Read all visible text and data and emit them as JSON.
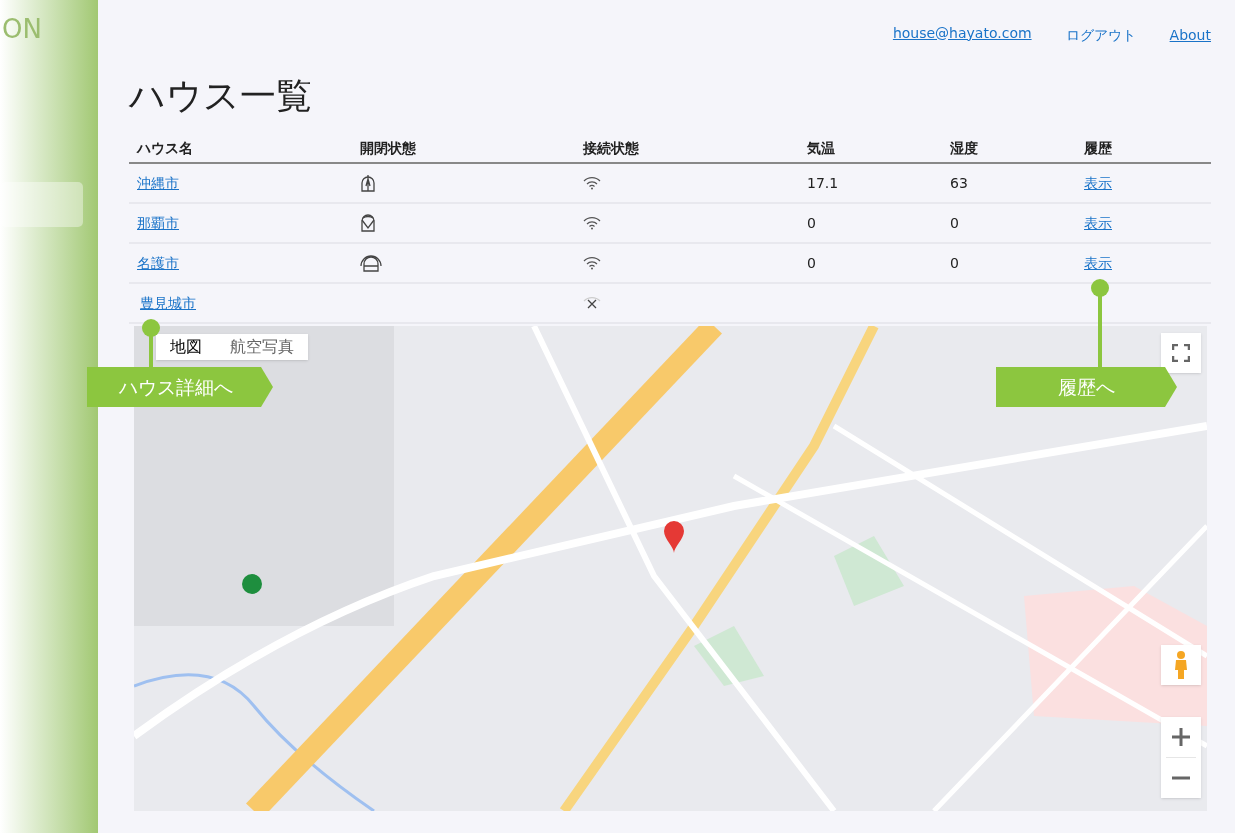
{
  "logo": "ON",
  "sidebar": {
    "items": [
      {
        "selected": true
      }
    ]
  },
  "header": {
    "email": "house@hayato.com",
    "logout": "ログアウト",
    "about": "About"
  },
  "title": "ハウス一覧",
  "table": {
    "columns": [
      "ハウス名",
      "開閉状態",
      "接続状態",
      "気温",
      "湿度",
      "履歴"
    ],
    "rows": [
      {
        "name": "沖縄市",
        "kind": "open",
        "connected": true,
        "temperature": "17.1",
        "humidity": "63",
        "history": "表示"
      },
      {
        "name": "那覇市",
        "kind": "half",
        "connected": true,
        "temperature": "0",
        "humidity": "0",
        "history": "表示"
      },
      {
        "name": "名護市",
        "kind": "closed",
        "connected": true,
        "temperature": "0",
        "humidity": "0",
        "history": "表示"
      },
      {
        "name": "豊見城市",
        "kind": "none",
        "connected": false
      }
    ]
  },
  "map": {
    "map_types": [
      {
        "label": "地図",
        "selected": true
      },
      {
        "label": "航空写真",
        "selected": false
      }
    ]
  },
  "callouts": [
    {
      "label": "ハウス詳細へ"
    },
    {
      "label": "履歴へ"
    }
  ]
}
